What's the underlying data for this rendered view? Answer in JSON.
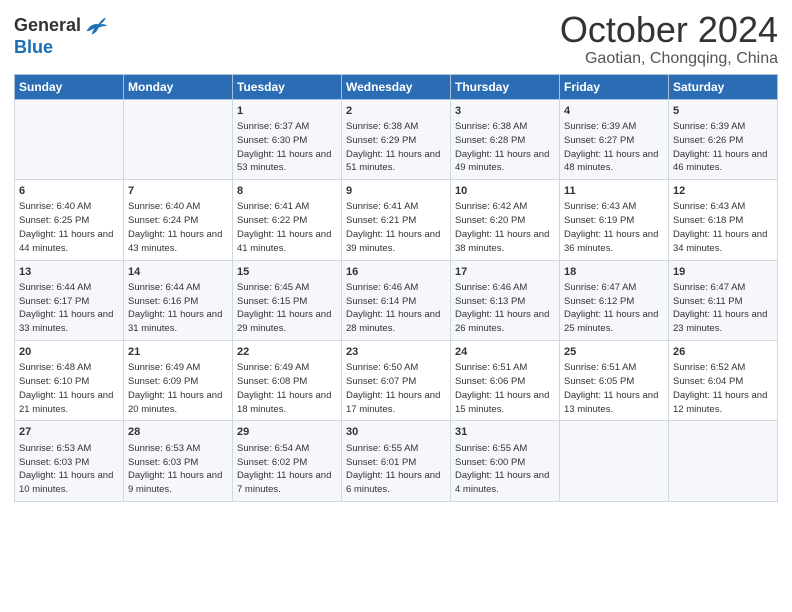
{
  "logo": {
    "line1": "General",
    "line2": "Blue",
    "bird_color": "#1a6fb5"
  },
  "title": "October 2024",
  "subtitle": "Gaotian, Chongqing, China",
  "days_of_week": [
    "Sunday",
    "Monday",
    "Tuesday",
    "Wednesday",
    "Thursday",
    "Friday",
    "Saturday"
  ],
  "weeks": [
    [
      {
        "day": "",
        "content": ""
      },
      {
        "day": "",
        "content": ""
      },
      {
        "day": "1",
        "content": "Sunrise: 6:37 AM\nSunset: 6:30 PM\nDaylight: 11 hours and 53 minutes."
      },
      {
        "day": "2",
        "content": "Sunrise: 6:38 AM\nSunset: 6:29 PM\nDaylight: 11 hours and 51 minutes."
      },
      {
        "day": "3",
        "content": "Sunrise: 6:38 AM\nSunset: 6:28 PM\nDaylight: 11 hours and 49 minutes."
      },
      {
        "day": "4",
        "content": "Sunrise: 6:39 AM\nSunset: 6:27 PM\nDaylight: 11 hours and 48 minutes."
      },
      {
        "day": "5",
        "content": "Sunrise: 6:39 AM\nSunset: 6:26 PM\nDaylight: 11 hours and 46 minutes."
      }
    ],
    [
      {
        "day": "6",
        "content": "Sunrise: 6:40 AM\nSunset: 6:25 PM\nDaylight: 11 hours and 44 minutes."
      },
      {
        "day": "7",
        "content": "Sunrise: 6:40 AM\nSunset: 6:24 PM\nDaylight: 11 hours and 43 minutes."
      },
      {
        "day": "8",
        "content": "Sunrise: 6:41 AM\nSunset: 6:22 PM\nDaylight: 11 hours and 41 minutes."
      },
      {
        "day": "9",
        "content": "Sunrise: 6:41 AM\nSunset: 6:21 PM\nDaylight: 11 hours and 39 minutes."
      },
      {
        "day": "10",
        "content": "Sunrise: 6:42 AM\nSunset: 6:20 PM\nDaylight: 11 hours and 38 minutes."
      },
      {
        "day": "11",
        "content": "Sunrise: 6:43 AM\nSunset: 6:19 PM\nDaylight: 11 hours and 36 minutes."
      },
      {
        "day": "12",
        "content": "Sunrise: 6:43 AM\nSunset: 6:18 PM\nDaylight: 11 hours and 34 minutes."
      }
    ],
    [
      {
        "day": "13",
        "content": "Sunrise: 6:44 AM\nSunset: 6:17 PM\nDaylight: 11 hours and 33 minutes."
      },
      {
        "day": "14",
        "content": "Sunrise: 6:44 AM\nSunset: 6:16 PM\nDaylight: 11 hours and 31 minutes."
      },
      {
        "day": "15",
        "content": "Sunrise: 6:45 AM\nSunset: 6:15 PM\nDaylight: 11 hours and 29 minutes."
      },
      {
        "day": "16",
        "content": "Sunrise: 6:46 AM\nSunset: 6:14 PM\nDaylight: 11 hours and 28 minutes."
      },
      {
        "day": "17",
        "content": "Sunrise: 6:46 AM\nSunset: 6:13 PM\nDaylight: 11 hours and 26 minutes."
      },
      {
        "day": "18",
        "content": "Sunrise: 6:47 AM\nSunset: 6:12 PM\nDaylight: 11 hours and 25 minutes."
      },
      {
        "day": "19",
        "content": "Sunrise: 6:47 AM\nSunset: 6:11 PM\nDaylight: 11 hours and 23 minutes."
      }
    ],
    [
      {
        "day": "20",
        "content": "Sunrise: 6:48 AM\nSunset: 6:10 PM\nDaylight: 11 hours and 21 minutes."
      },
      {
        "day": "21",
        "content": "Sunrise: 6:49 AM\nSunset: 6:09 PM\nDaylight: 11 hours and 20 minutes."
      },
      {
        "day": "22",
        "content": "Sunrise: 6:49 AM\nSunset: 6:08 PM\nDaylight: 11 hours and 18 minutes."
      },
      {
        "day": "23",
        "content": "Sunrise: 6:50 AM\nSunset: 6:07 PM\nDaylight: 11 hours and 17 minutes."
      },
      {
        "day": "24",
        "content": "Sunrise: 6:51 AM\nSunset: 6:06 PM\nDaylight: 11 hours and 15 minutes."
      },
      {
        "day": "25",
        "content": "Sunrise: 6:51 AM\nSunset: 6:05 PM\nDaylight: 11 hours and 13 minutes."
      },
      {
        "day": "26",
        "content": "Sunrise: 6:52 AM\nSunset: 6:04 PM\nDaylight: 11 hours and 12 minutes."
      }
    ],
    [
      {
        "day": "27",
        "content": "Sunrise: 6:53 AM\nSunset: 6:03 PM\nDaylight: 11 hours and 10 minutes."
      },
      {
        "day": "28",
        "content": "Sunrise: 6:53 AM\nSunset: 6:03 PM\nDaylight: 11 hours and 9 minutes."
      },
      {
        "day": "29",
        "content": "Sunrise: 6:54 AM\nSunset: 6:02 PM\nDaylight: 11 hours and 7 minutes."
      },
      {
        "day": "30",
        "content": "Sunrise: 6:55 AM\nSunset: 6:01 PM\nDaylight: 11 hours and 6 minutes."
      },
      {
        "day": "31",
        "content": "Sunrise: 6:55 AM\nSunset: 6:00 PM\nDaylight: 11 hours and 4 minutes."
      },
      {
        "day": "",
        "content": ""
      },
      {
        "day": "",
        "content": ""
      }
    ]
  ]
}
